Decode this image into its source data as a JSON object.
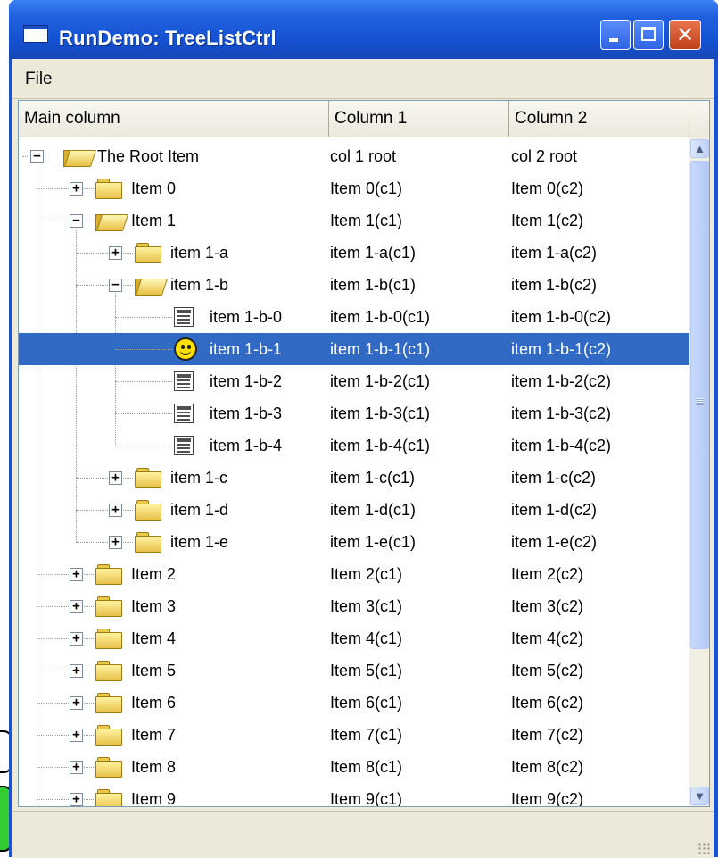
{
  "window": {
    "title": "RunDemo: TreeListCtrl"
  },
  "menubar": {
    "items": [
      "File"
    ]
  },
  "columns": [
    "Main column",
    "Column 1",
    "Column 2"
  ],
  "rows": [
    {
      "label": "The Root Item",
      "c1": "col 1 root",
      "c2": "col 2 root",
      "level": 0,
      "expander": "−",
      "icon": "folder-open-icon"
    },
    {
      "label": "Item 0",
      "c1": "Item 0(c1)",
      "c2": "Item 0(c2)",
      "level": 1,
      "expander": "+",
      "icon": "folder-icon"
    },
    {
      "label": "Item 1",
      "c1": "Item 1(c1)",
      "c2": "Item 1(c2)",
      "level": 1,
      "expander": "−",
      "icon": "folder-open-icon"
    },
    {
      "label": "item 1-a",
      "c1": "item 1-a(c1)",
      "c2": "item 1-a(c2)",
      "level": 2,
      "expander": "+",
      "icon": "folder-icon"
    },
    {
      "label": "item 1-b",
      "c1": "item 1-b(c1)",
      "c2": "item 1-b(c2)",
      "level": 2,
      "expander": "−",
      "icon": "folder-open-icon"
    },
    {
      "label": "item 1-b-0",
      "c1": "item 1-b-0(c1)",
      "c2": "item 1-b-0(c2)",
      "level": 3,
      "expander": "",
      "icon": "document-icon"
    },
    {
      "label": "item 1-b-1",
      "c1": "item 1-b-1(c1)",
      "c2": "item 1-b-1(c2)",
      "level": 3,
      "expander": "",
      "icon": "smiley-icon",
      "selected": true
    },
    {
      "label": "item 1-b-2",
      "c1": "item 1-b-2(c1)",
      "c2": "item 1-b-2(c2)",
      "level": 3,
      "expander": "",
      "icon": "document-icon"
    },
    {
      "label": "item 1-b-3",
      "c1": "item 1-b-3(c1)",
      "c2": "item 1-b-3(c2)",
      "level": 3,
      "expander": "",
      "icon": "document-icon"
    },
    {
      "label": "item 1-b-4",
      "c1": "item 1-b-4(c1)",
      "c2": "item 1-b-4(c2)",
      "level": 3,
      "expander": "",
      "icon": "document-icon"
    },
    {
      "label": "item 1-c",
      "c1": "item 1-c(c1)",
      "c2": "item 1-c(c2)",
      "level": 2,
      "expander": "+",
      "icon": "folder-icon"
    },
    {
      "label": "item 1-d",
      "c1": "item 1-d(c1)",
      "c2": "item 1-d(c2)",
      "level": 2,
      "expander": "+",
      "icon": "folder-icon"
    },
    {
      "label": "item 1-e",
      "c1": "item 1-e(c1)",
      "c2": "item 1-e(c2)",
      "level": 2,
      "expander": "+",
      "icon": "folder-icon"
    },
    {
      "label": "Item 2",
      "c1": "Item 2(c1)",
      "c2": "Item 2(c2)",
      "level": 1,
      "expander": "+",
      "icon": "folder-icon"
    },
    {
      "label": "Item 3",
      "c1": "Item 3(c1)",
      "c2": "Item 3(c2)",
      "level": 1,
      "expander": "+",
      "icon": "folder-icon"
    },
    {
      "label": "Item 4",
      "c1": "Item 4(c1)",
      "c2": "Item 4(c2)",
      "level": 1,
      "expander": "+",
      "icon": "folder-icon"
    },
    {
      "label": "Item 5",
      "c1": "Item 5(c1)",
      "c2": "Item 5(c2)",
      "level": 1,
      "expander": "+",
      "icon": "folder-icon"
    },
    {
      "label": "Item 6",
      "c1": "Item 6(c1)",
      "c2": "Item 6(c2)",
      "level": 1,
      "expander": "+",
      "icon": "folder-icon"
    },
    {
      "label": "Item 7",
      "c1": "Item 7(c1)",
      "c2": "Item 7(c2)",
      "level": 1,
      "expander": "+",
      "icon": "folder-icon"
    },
    {
      "label": "Item 8",
      "c1": "Item 8(c1)",
      "c2": "Item 8(c2)",
      "level": 1,
      "expander": "+",
      "icon": "folder-icon"
    },
    {
      "label": "Item 9",
      "c1": "Item 9(c1)",
      "c2": "Item 9(c2)",
      "level": 1,
      "expander": "+",
      "icon": "folder-icon"
    }
  ],
  "colors": {
    "selection": "#316ac5",
    "titlebar": "#1f5fdd",
    "face": "#ece9d8"
  }
}
